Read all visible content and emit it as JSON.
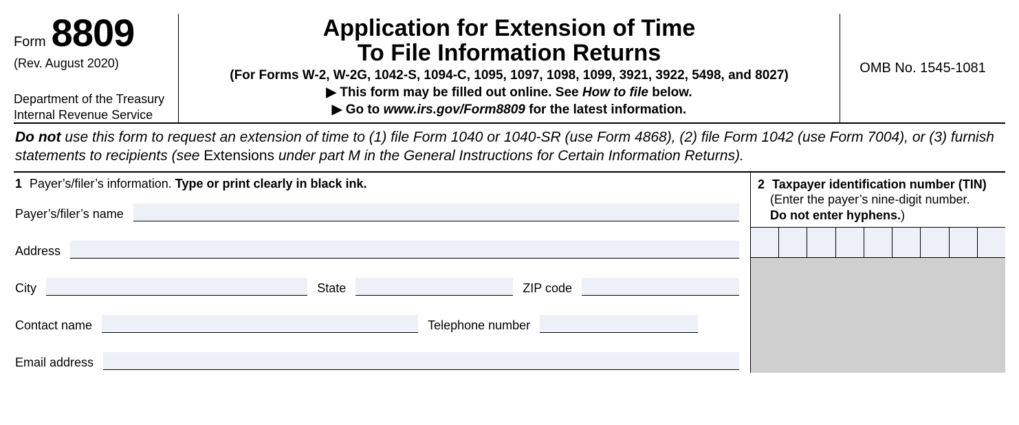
{
  "header": {
    "form_word": "Form",
    "form_number": "8809",
    "revision": "(Rev. August 2020)",
    "dept_line1": "Department of the Treasury",
    "dept_line2": "Internal Revenue Service",
    "title_line1": "Application for Extension of Time",
    "title_line2": "To File Information Returns",
    "forms_list": "(For Forms W-2, W-2G, 1042-S, 1094-C, 1095, 1097, 1098, 1099, 3921, 3922, 5498, and 8027)",
    "note1_pre": "This form may be filled out online. See ",
    "note1_em": "How to file",
    "note1_post": " below.",
    "note2_pre": "Go to ",
    "note2_em": "www.irs.gov/Form8809",
    "note2_post": " for the latest information.",
    "omb": "OMB No. 1545-1081"
  },
  "warning": {
    "dn": "Do not",
    "part1": " use this form to request an extension of time to (1) file Form 1040 or 1040-SR (use Form 4868), (2) file Form 1042 (use Form 7004), or (3) furnish statements to recipients (see ",
    "upright": "Extensions",
    "part2": " under part M in the General Instructions for Certain Information Returns)."
  },
  "box1": {
    "num": "1",
    "intro_plain": "Payer’s/filer’s information. ",
    "intro_bold": "Type or print clearly in black ink.",
    "name_label": "Payer’s/filer’s name",
    "address_label": "Address",
    "city_label": "City",
    "state_label": "State",
    "zip_label": "ZIP code",
    "contact_label": "Contact name",
    "phone_label": "Telephone number",
    "email_label": "Email address",
    "values": {
      "name": "",
      "address": "",
      "city": "",
      "state": "",
      "zip": "",
      "contact": "",
      "phone": "",
      "email": ""
    }
  },
  "box2": {
    "num": "2",
    "title": "Taxpayer identification number (TIN)",
    "hint1": "(Enter the payer’s nine-digit number.",
    "hint2_bold": "Do not enter hyphens.",
    "hint2_close": ")",
    "digits": [
      "",
      "",
      "",
      "",
      "",
      "",
      "",
      "",
      ""
    ]
  }
}
